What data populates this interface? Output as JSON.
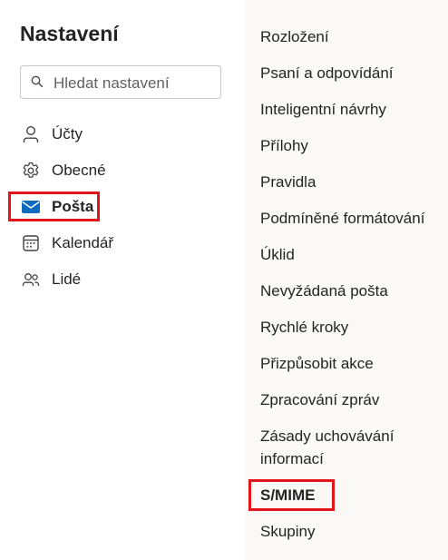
{
  "settings": {
    "title": "Nastavení",
    "search": {
      "placeholder": "Hledat nastavení",
      "value": ""
    },
    "nav": [
      {
        "label": "Účty",
        "icon": "person-icon"
      },
      {
        "label": "Obecné",
        "icon": "gear-icon"
      },
      {
        "label": "Pošta",
        "icon": "mail-icon",
        "selected": true
      },
      {
        "label": "Kalendář",
        "icon": "calendar-icon"
      },
      {
        "label": "Lidé",
        "icon": "people-icon"
      }
    ],
    "subnav": [
      "Rozložení",
      "Psaní a odpovídání",
      "Inteligentní návrhy",
      "Přílohy",
      "Pravidla",
      "Podmíněné formátování",
      "Úklid",
      "Nevyžádaná pošta",
      "Rychlé kroky",
      "Přizpůsobit akce",
      "Zpracování zpráv",
      "Zásady uchovávání",
      "informací",
      "S/MIME",
      "Skupiny"
    ]
  },
  "colors": {
    "accent": "#0f6cbd",
    "highlight": "#e0161b",
    "text": "#242424",
    "panel": "#faf9f8"
  }
}
